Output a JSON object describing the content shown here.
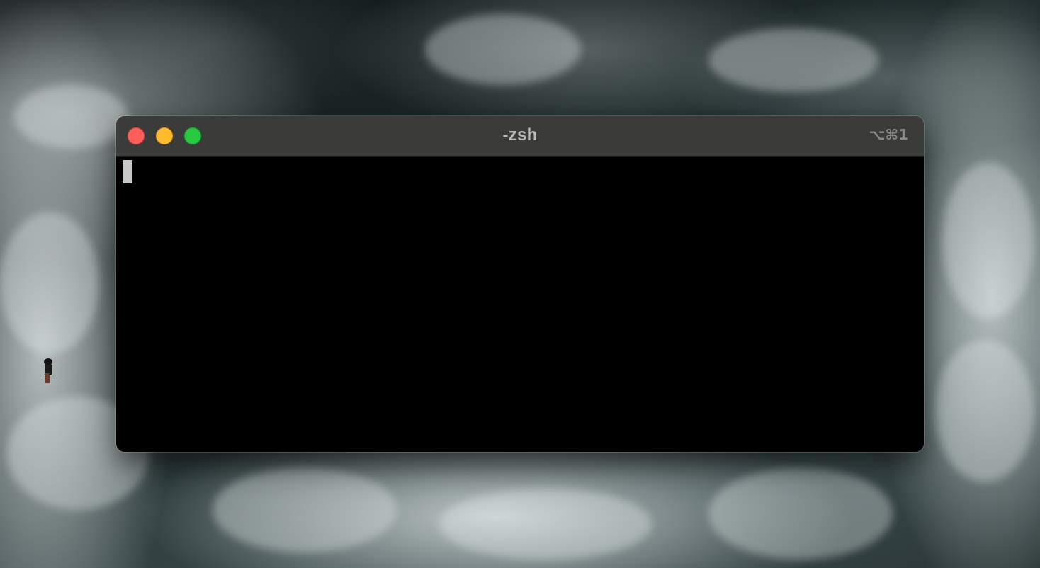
{
  "window": {
    "title": "-zsh",
    "shortcut": "⌥⌘1"
  },
  "traffic_lights": {
    "close_color": "#ff5f57",
    "minimize_color": "#febc2e",
    "maximize_color": "#28c840"
  },
  "colors": {
    "title_bar": "#3b3b3a",
    "terminal_background": "#000000",
    "cursor": "#c8c8c8"
  },
  "wallpaper": {
    "description_icon": "ocean-waves-wallpaper"
  }
}
